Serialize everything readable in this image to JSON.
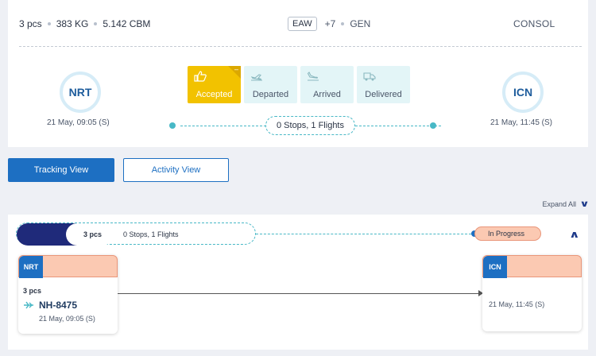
{
  "summary": {
    "pieces": "3 pcs",
    "weight": "383 KG",
    "volume": "5.142 CBM",
    "eaw": "EAW",
    "plus": "+7",
    "gen": "GEN",
    "consol": "CONSOL"
  },
  "origin": {
    "code": "NRT",
    "time": "21 May, 09:05 (S)"
  },
  "destination": {
    "code": "ICN",
    "time": "21 May, 11:45 (S)"
  },
  "statuses": [
    {
      "label": "Accepted",
      "icon": "thumbs-up-icon",
      "active": true
    },
    {
      "label": "Departed",
      "icon": "plane-departure-icon",
      "active": false
    },
    {
      "label": "Arrived",
      "icon": "plane-arrival-icon",
      "active": false
    },
    {
      "label": "Delivered",
      "icon": "truck-icon",
      "active": false
    }
  ],
  "route": {
    "stops": "0 Stops, 1 Flights"
  },
  "views": {
    "tracking": "Tracking View",
    "activity": "Activity View"
  },
  "expand_all": "Expand All",
  "detail": {
    "pieces": "3 pcs",
    "stops": "0 Stops, 1 Flights",
    "progress": "In Progress",
    "leg": {
      "from": "NRT",
      "to": "ICN",
      "pieces": "3 pcs",
      "flight": "NH-8475",
      "dep_time": "21 May, 09:05 (S)",
      "arr_time": "21 May, 11:45 (S)"
    }
  },
  "colors": {
    "accent": "#1d6fc2",
    "accepted": "#f2c200",
    "teal": "#48b8c6",
    "progress_bg": "#fbc9b2",
    "navy": "#1f2a7a"
  }
}
